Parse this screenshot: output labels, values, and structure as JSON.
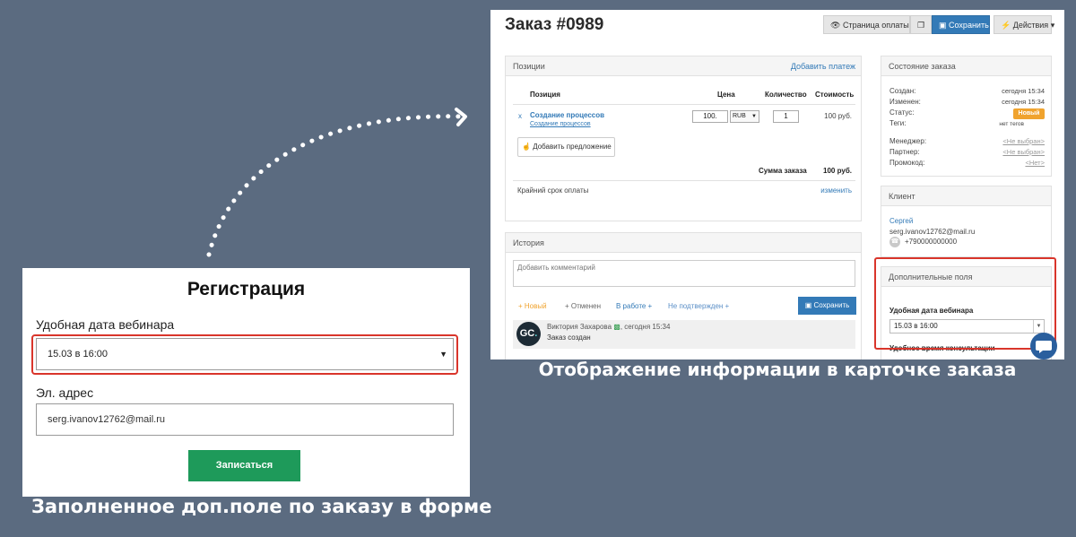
{
  "registration": {
    "title": "Регистрация",
    "date_label": "Удобная дата вебинара",
    "date_value": "15.03 в 16:00",
    "email_label": "Эл. адрес",
    "email_value": "serg.ivanov12762@mail.ru",
    "submit_label": "Записаться"
  },
  "captions": {
    "left": "Заполненное доп.поле по заказу в форме",
    "right": "Отображение информации в карточке заказа"
  },
  "order": {
    "title": "Заказ #0989",
    "toolbar": {
      "payment_page_label": "Страница оплаты",
      "save_label": "Сохранить",
      "actions_label": "Действия"
    },
    "positions": {
      "header": "Позиции",
      "add_payment_link": "Добавить платеж",
      "columns": [
        "Позиция",
        "Цена",
        "Количество",
        "Стоимость"
      ],
      "item": {
        "remove": "x",
        "name": "Создание процессов",
        "sub_link": "Создание процессов",
        "price": "100.",
        "currency": "RUB",
        "quantity": "1",
        "cost": "100 руб."
      },
      "add_offer_label": "Добавить предложение",
      "sum_label": "Сумма заказа",
      "sum_value": "100 руб.",
      "due_label": "Крайний срок оплаты",
      "due_link": "изменить"
    },
    "history": {
      "header": "История",
      "comment_placeholder": "Добавить комментарий",
      "filters": [
        {
          "label": "+ Новый",
          "color": "#f0a32e"
        },
        {
          "label": "+ Отменен",
          "color": "#666666"
        },
        {
          "label": "В работе +",
          "color": "#337ab7"
        },
        {
          "label": "Не подтвержден +",
          "color": "#5b8fc7"
        }
      ],
      "save_label": "Сохранить",
      "entry": {
        "avatar": "GC",
        "author": "Виктория Захарова",
        "time": ", сегодня 15:34",
        "message": "Заказ создан"
      }
    },
    "state": {
      "header": "Состояние заказа",
      "created_label": "Создан:",
      "created_value": "сегодня 15:34",
      "changed_label": "Изменен:",
      "changed_value": "сегодня 15:34",
      "status_label": "Статус:",
      "status_value": "Новый",
      "tags_label": "Теги:",
      "tags_value": "нет тегов",
      "manager_label": "Менеджер:",
      "manager_value": "<Не выбран>",
      "partner_label": "Партнер:",
      "partner_value": "<Не выбран>",
      "promo_label": "Промокод:",
      "promo_value": "<Нет>"
    },
    "client": {
      "header": "Клиент",
      "name": "Сергей",
      "email": "serg.ivanov12762@mail.ru",
      "phone": "+790000000000"
    },
    "extra_fields": {
      "header": "Дополнительные поля",
      "webinar_date_label": "Удобная дата вебинара",
      "webinar_date_value": "15.03 в 16:00",
      "next_label": "Удобное время консультации"
    }
  },
  "colors": {
    "background": "#5b6b80",
    "primary": "#337ab7",
    "submit_green": "#1e9a5a",
    "highlight_red": "#d9352b",
    "status_orange": "#f0a32e"
  }
}
